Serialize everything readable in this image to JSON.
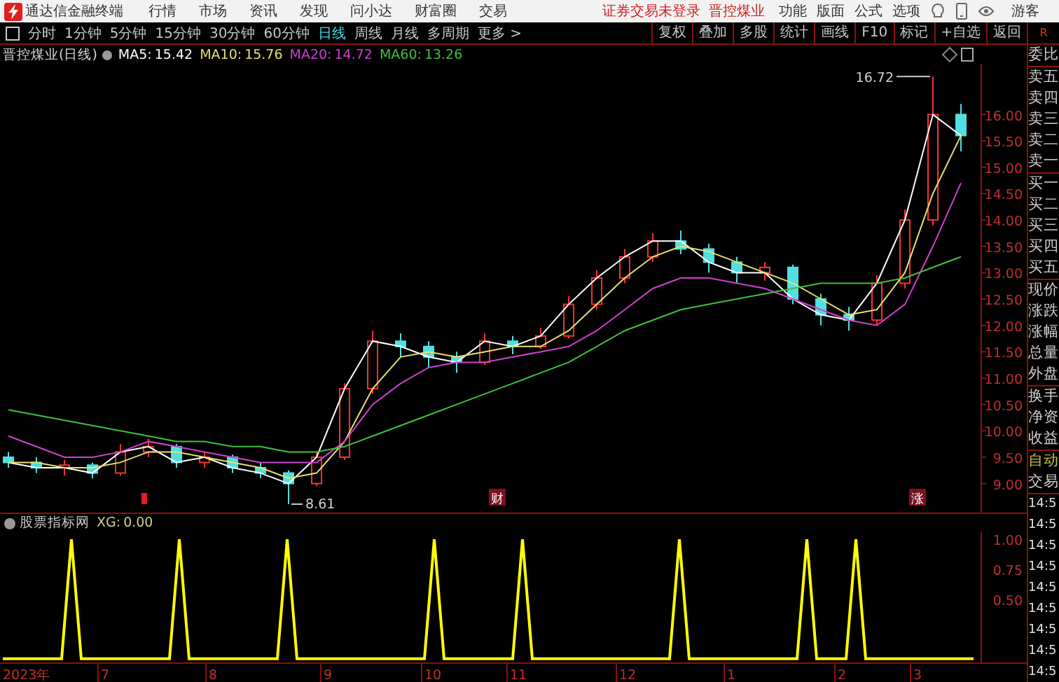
{
  "app": {
    "title": "通达信金融终端",
    "menu": [
      "行情",
      "市场",
      "资讯",
      "发现",
      "问小达",
      "财富圈",
      "交易"
    ],
    "notice": "证券交易未登录",
    "stock_link": "晋控煤业",
    "tools": [
      "功能",
      "版面",
      "公式",
      "选项"
    ],
    "user": "游客"
  },
  "periods": [
    {
      "label": "分时",
      "selected": false
    },
    {
      "label": "1分钟",
      "selected": false
    },
    {
      "label": "5分钟",
      "selected": false
    },
    {
      "label": "15分钟",
      "selected": false
    },
    {
      "label": "30分钟",
      "selected": false
    },
    {
      "label": "60分钟",
      "selected": false
    },
    {
      "label": "日线",
      "selected": true
    },
    {
      "label": "周线",
      "selected": false
    },
    {
      "label": "月线",
      "selected": false
    },
    {
      "label": "多周期",
      "selected": false
    },
    {
      "label": "更多 >",
      "selected": false
    }
  ],
  "chart_buttons": [
    "复权",
    "叠加",
    "多股",
    "统计",
    "画线",
    "F10",
    "标记",
    "+自选",
    "返回"
  ],
  "panel_badge": "R",
  "header": {
    "title": "晋控煤业(日线)",
    "ma": [
      {
        "value": "15.42",
        "color": "#ffffff"
      },
      {
        "value": "15.76",
        "color": "#e8e070"
      },
      {
        "value": "14.72",
        "color": "#d040d0"
      },
      {
        "value": "13.26",
        "color": "#40c040"
      }
    ]
  },
  "main_chart": {
    "chart_data": {
      "type": "candlestick",
      "ylim": [
        8.45,
        16.95
      ],
      "yticks": [
        {
          "value": 9,
          "label": "9.00"
        },
        {
          "value": 9.5,
          "label": "9.50"
        },
        {
          "value": 10,
          "label": "10.00"
        },
        {
          "value": 10.5,
          "label": "10.50"
        },
        {
          "value": 11,
          "label": "11.00"
        },
        {
          "value": 11.5,
          "label": "11.50"
        },
        {
          "value": 12,
          "label": "12.00"
        },
        {
          "value": 12.5,
          "label": "12.50"
        },
        {
          "value": 13,
          "label": "13.00"
        },
        {
          "value": 13.5,
          "label": "13.50"
        },
        {
          "value": 14,
          "label": "14.00"
        },
        {
          "value": 14.5,
          "label": "14.50"
        },
        {
          "value": 15,
          "label": "15.00"
        },
        {
          "value": 15.5,
          "label": "15.50"
        },
        {
          "value": 16,
          "label": "16.00"
        }
      ],
      "ohlc": [
        [
          9.5,
          9.6,
          9.3,
          9.4
        ],
        [
          9.4,
          9.5,
          9.2,
          9.3
        ],
        [
          9.3,
          9.45,
          9.15,
          9.35
        ],
        [
          9.35,
          9.4,
          9.1,
          9.2
        ],
        [
          9.2,
          9.75,
          9.15,
          9.6
        ],
        [
          9.6,
          9.85,
          9.5,
          9.7
        ],
        [
          9.7,
          9.75,
          9.3,
          9.4
        ],
        [
          9.4,
          9.6,
          9.3,
          9.5
        ],
        [
          9.5,
          9.55,
          9.2,
          9.3
        ],
        [
          9.3,
          9.4,
          9.1,
          9.2
        ],
        [
          9.2,
          9.25,
          8.61,
          9.0
        ],
        [
          9.0,
          9.6,
          8.95,
          9.5
        ],
        [
          9.5,
          10.9,
          9.45,
          10.8
        ],
        [
          10.8,
          11.9,
          10.7,
          11.7
        ],
        [
          11.7,
          11.85,
          11.4,
          11.6
        ],
        [
          11.6,
          11.7,
          11.2,
          11.4
        ],
        [
          11.4,
          11.5,
          11.1,
          11.3
        ],
        [
          11.3,
          11.85,
          11.25,
          11.7
        ],
        [
          11.7,
          11.8,
          11.45,
          11.6
        ],
        [
          11.6,
          11.95,
          11.55,
          11.8
        ],
        [
          11.8,
          12.55,
          11.75,
          12.4
        ],
        [
          12.4,
          13.05,
          12.3,
          12.9
        ],
        [
          12.9,
          13.45,
          12.8,
          13.3
        ],
        [
          13.3,
          13.75,
          13.2,
          13.6
        ],
        [
          13.6,
          13.8,
          13.35,
          13.45
        ],
        [
          13.45,
          13.55,
          13.0,
          13.2
        ],
        [
          13.2,
          13.3,
          12.8,
          13.0
        ],
        [
          13.0,
          13.2,
          12.85,
          13.1
        ],
        [
          13.1,
          13.15,
          12.4,
          12.5
        ],
        [
          12.5,
          12.6,
          12.0,
          12.2
        ],
        [
          12.2,
          12.35,
          11.9,
          12.1
        ],
        [
          12.1,
          12.95,
          12.0,
          12.8
        ],
        [
          12.8,
          14.2,
          12.7,
          14.0
        ],
        [
          14.0,
          16.72,
          13.9,
          16.0
        ],
        [
          16.0,
          16.2,
          15.3,
          15.6
        ]
      ],
      "series": [
        {
          "name": "MA5:",
          "type": "line",
          "color": "#ffffff",
          "values": [
            9.4,
            9.3,
            9.3,
            9.2,
            9.6,
            9.7,
            9.4,
            9.5,
            9.3,
            9.2,
            9.0,
            9.5,
            10.8,
            11.7,
            11.6,
            11.4,
            11.3,
            11.7,
            11.6,
            11.8,
            12.4,
            12.9,
            13.3,
            13.6,
            13.6,
            13.2,
            13.0,
            13.0,
            12.5,
            12.2,
            12.1,
            12.8,
            14.0,
            16.0,
            15.6
          ]
        },
        {
          "name": "MA10:",
          "type": "line",
          "color": "#e8e070",
          "values": [
            9.4,
            9.4,
            9.3,
            9.3,
            9.4,
            9.6,
            9.6,
            9.5,
            9.4,
            9.3,
            9.1,
            9.2,
            9.8,
            10.8,
            11.4,
            11.5,
            11.4,
            11.5,
            11.6,
            11.6,
            11.9,
            12.4,
            12.9,
            13.3,
            13.5,
            13.4,
            13.2,
            13.0,
            12.8,
            12.5,
            12.2,
            12.3,
            13.0,
            14.5,
            15.6
          ]
        },
        {
          "name": "MA20:",
          "type": "line",
          "color": "#d040d0",
          "values": [
            9.9,
            9.7,
            9.5,
            9.5,
            9.6,
            9.8,
            9.7,
            9.6,
            9.5,
            9.4,
            9.4,
            9.4,
            9.8,
            10.5,
            10.9,
            11.2,
            11.3,
            11.3,
            11.4,
            11.5,
            11.6,
            11.9,
            12.3,
            12.7,
            12.9,
            12.9,
            12.8,
            12.7,
            12.5,
            12.3,
            12.1,
            12.0,
            12.4,
            13.5,
            14.7
          ]
        },
        {
          "name": "MA60:",
          "type": "line",
          "color": "#40c040",
          "values": [
            10.4,
            10.3,
            10.2,
            10.1,
            10.0,
            9.9,
            9.8,
            9.8,
            9.7,
            9.7,
            9.6,
            9.6,
            9.7,
            9.9,
            10.1,
            10.3,
            10.5,
            10.7,
            10.9,
            11.1,
            11.3,
            11.6,
            11.9,
            12.1,
            12.3,
            12.4,
            12.5,
            12.6,
            12.7,
            12.8,
            12.8,
            12.8,
            12.9,
            13.1,
            13.3
          ]
        }
      ],
      "annotations": [
        "16.72",
        "8.61"
      ]
    }
  },
  "event_marks": [
    {
      "kind": "flag"
    },
    {
      "kind": "badge",
      "label": "财"
    },
    {
      "kind": "badge",
      "label": "涨"
    }
  ],
  "indicator": {
    "title": "股票指标网",
    "reading": "0.00",
    "chart_data": {
      "type": "line",
      "ylim": [
        -0.03,
        1.06
      ],
      "yticks": [
        {
          "value": 0.5,
          "label": "0.50"
        },
        {
          "value": 0.75,
          "label": "0.75"
        },
        {
          "value": 1,
          "label": "1.00"
        }
      ],
      "series": [
        {
          "name": "XG:",
          "color": "#ffff00",
          "values": [
            0,
            0,
            0,
            0,
            0,
            0,
            0,
            1,
            0,
            0,
            0,
            0,
            0,
            0,
            0,
            0,
            0,
            0,
            1,
            0,
            0,
            0,
            0,
            0,
            0,
            0,
            0,
            0,
            0,
            1,
            0,
            0,
            0,
            0,
            0,
            0,
            0,
            0,
            0,
            0,
            0,
            0,
            0,
            0,
            1,
            0,
            0,
            0,
            0,
            0,
            0,
            0,
            0,
            1,
            0,
            0,
            0,
            0,
            0,
            0,
            0,
            0,
            0,
            0,
            0,
            0,
            0,
            0,
            0,
            1,
            0,
            0,
            0,
            0,
            0,
            0,
            0,
            0,
            0,
            0,
            0,
            0,
            1,
            0,
            0,
            0,
            0,
            1,
            0,
            0,
            0,
            0,
            0,
            0,
            0,
            0,
            0,
            0,
            0,
            0
          ]
        }
      ]
    }
  },
  "date_axis": [
    "2023年",
    "7",
    "8",
    "9",
    "10",
    "11",
    "12",
    "1",
    "2",
    "3"
  ],
  "quote_panel": {
    "groups": [
      [
        {
          "label": "委比",
          "kind": "field"
        }
      ],
      [
        {
          "label": "卖五",
          "kind": "field"
        },
        {
          "label": "卖四",
          "kind": "field"
        },
        {
          "label": "卖三",
          "kind": "field"
        },
        {
          "label": "卖二",
          "kind": "field"
        },
        {
          "label": "卖一",
          "kind": "field"
        }
      ],
      [
        {
          "label": "买一",
          "kind": "field"
        },
        {
          "label": "买二",
          "kind": "field"
        },
        {
          "label": "买三",
          "kind": "field"
        },
        {
          "label": "买四",
          "kind": "field"
        },
        {
          "label": "买五",
          "kind": "field"
        }
      ],
      [
        {
          "label": "现价",
          "kind": "field"
        },
        {
          "label": "涨跌",
          "kind": "field"
        },
        {
          "label": "涨幅",
          "kind": "field"
        },
        {
          "label": "总量",
          "kind": "field"
        },
        {
          "label": "外盘",
          "kind": "field"
        }
      ],
      [
        {
          "label": "换手",
          "kind": "field"
        },
        {
          "label": "净资",
          "kind": "field"
        },
        {
          "label": "收益",
          "kind": "field"
        }
      ],
      [
        {
          "label": "自动",
          "kind": "mode"
        },
        {
          "label": "交易",
          "kind": "field"
        }
      ],
      [
        {
          "label": "14:5",
          "kind": "time"
        },
        {
          "label": "14:5",
          "kind": "time"
        },
        {
          "label": "14:5",
          "kind": "time"
        },
        {
          "label": "14:5",
          "kind": "time"
        },
        {
          "label": "14:5",
          "kind": "time"
        },
        {
          "label": "14:5",
          "kind": "time"
        },
        {
          "label": "14:5",
          "kind": "time"
        },
        {
          "label": "14:5",
          "kind": "time"
        },
        {
          "label": "14:5",
          "kind": "time"
        }
      ]
    ]
  }
}
